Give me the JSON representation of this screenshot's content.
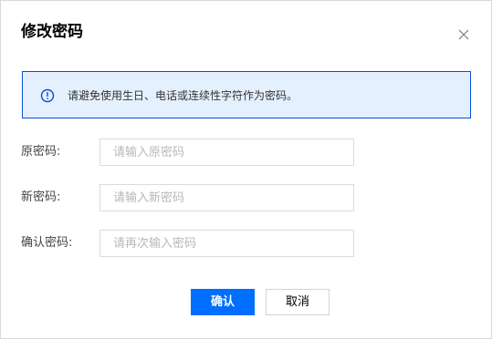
{
  "dialog": {
    "title": "修改密码",
    "close_icon": "close-icon"
  },
  "notice": {
    "icon": "info-icon",
    "text": "请避免使用生日、电话或连续性字符作为密码。",
    "accent_color": "#0052d9",
    "background_color": "#e5f0ff"
  },
  "form": {
    "old_password": {
      "label": "原密码:",
      "placeholder": "请输入原密码",
      "value": ""
    },
    "new_password": {
      "label": "新密码:",
      "placeholder": "请输入新密码",
      "value": ""
    },
    "confirm_password": {
      "label": "确认密码:",
      "placeholder": "请再次输入密码",
      "value": ""
    }
  },
  "buttons": {
    "confirm_label": "确认",
    "cancel_label": "取消",
    "primary_color": "#006eff"
  }
}
